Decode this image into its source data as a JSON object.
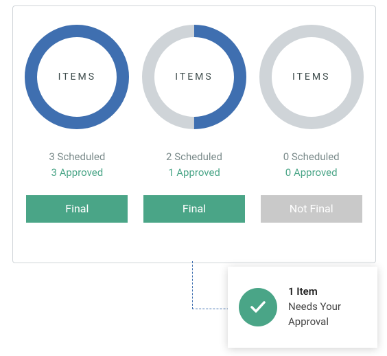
{
  "colors": {
    "accent_blue": "#3f6fb0",
    "accent_green": "#4aa587",
    "ring_track": "#cfd4d8",
    "gray_btn": "#c9c9c9",
    "muted_text": "#7a8a8a"
  },
  "ring_label": "ITEMS",
  "items": [
    {
      "progress": 1.0,
      "scheduled_text": "3 Scheduled",
      "approved_text": "3 Approved",
      "status_label": "Final",
      "status_kind": "final"
    },
    {
      "progress": 0.5,
      "scheduled_text": "2 Scheduled",
      "approved_text": "1 Approved",
      "status_label": "Final",
      "status_kind": "final"
    },
    {
      "progress": 0.0,
      "scheduled_text": "0 Scheduled",
      "approved_text": "0 Approved",
      "status_label": "Not Final",
      "status_kind": "notfinal"
    }
  ],
  "popup": {
    "line1": "1 Item",
    "line2": "Needs Your",
    "line3": "Approval"
  }
}
